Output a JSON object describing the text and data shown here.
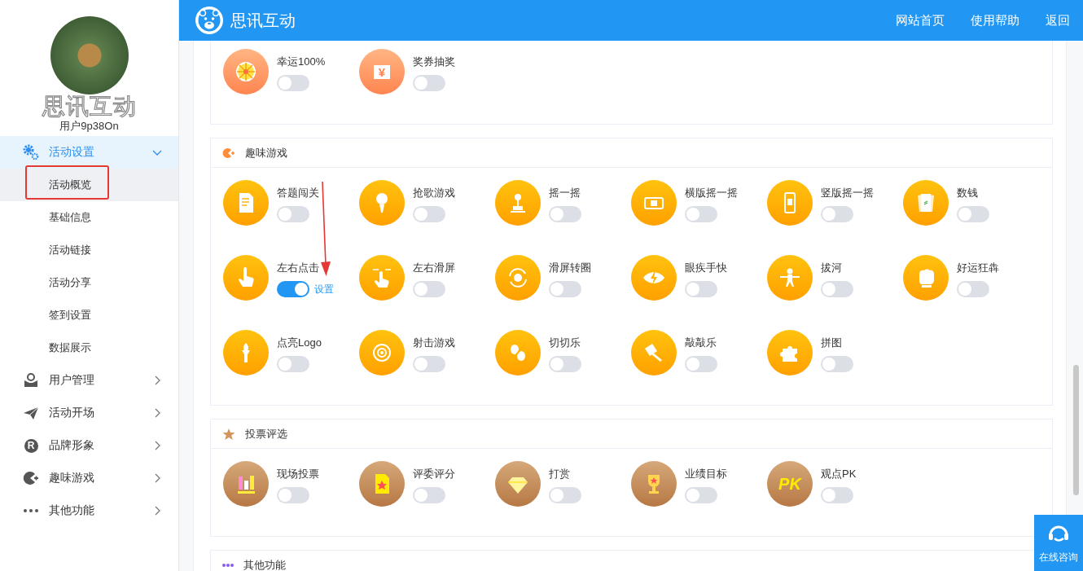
{
  "sidebar": {
    "logo_text": "思讯互动",
    "username": "用户9p38On",
    "menu": [
      {
        "label": "活动设置",
        "selected": true,
        "expanded": true,
        "children": [
          {
            "label": "活动概览",
            "selected": true,
            "annotated": true
          },
          {
            "label": "基础信息",
            "selected": false,
            "annotated": false
          },
          {
            "label": "活动链接",
            "selected": false,
            "annotated": false
          },
          {
            "label": "活动分享",
            "selected": false,
            "annotated": false
          },
          {
            "label": "签到设置",
            "selected": false,
            "annotated": false
          },
          {
            "label": "数据展示",
            "selected": false,
            "annotated": false
          }
        ]
      },
      {
        "label": "用户管理",
        "selected": false,
        "expanded": false
      },
      {
        "label": "活动开场",
        "selected": false,
        "expanded": false
      },
      {
        "label": "品牌形象",
        "selected": false,
        "expanded": false,
        "icon_text": "R"
      },
      {
        "label": "趣味游戏",
        "selected": false,
        "expanded": false
      },
      {
        "label": "其他功能",
        "selected": false,
        "expanded": false
      }
    ]
  },
  "header": {
    "title": "思讯互动",
    "links": [
      "网站首页",
      "使用帮助",
      "返回"
    ]
  },
  "sections": [
    {
      "kind": "lottery",
      "items": [
        {
          "label": "幸运100%",
          "on": false
        },
        {
          "label": "奖券抽奖",
          "on": false,
          "icon_text": "¥"
        }
      ]
    },
    {
      "kind": "game",
      "title": "趣味游戏",
      "items": [
        {
          "label": "答题闯关",
          "on": false
        },
        {
          "label": "抢歌游戏",
          "on": false
        },
        {
          "label": "摇一摇",
          "on": false
        },
        {
          "label": "横版摇一摇",
          "on": false
        },
        {
          "label": "竖版摇一摇",
          "on": false
        },
        {
          "label": "数钱",
          "on": false
        },
        {
          "label": "左右点击",
          "on": true,
          "settings": "设置",
          "annotated": true
        },
        {
          "label": "左右滑屏",
          "on": false
        },
        {
          "label": "滑屏转圈",
          "on": false
        },
        {
          "label": "眼疾手快",
          "on": false
        },
        {
          "label": "拔河",
          "on": false
        },
        {
          "label": "好运狂犇",
          "on": false
        },
        {
          "label": "点亮Logo",
          "on": false
        },
        {
          "label": "射击游戏",
          "on": false
        },
        {
          "label": "切切乐",
          "on": false
        },
        {
          "label": "敲敲乐",
          "on": false
        },
        {
          "label": "拼图",
          "on": false
        }
      ]
    },
    {
      "kind": "vote",
      "title": "投票评选",
      "items": [
        {
          "label": "现场投票",
          "on": false
        },
        {
          "label": "评委评分",
          "on": false
        },
        {
          "label": "打赏",
          "on": false
        },
        {
          "label": "业绩目标",
          "on": false
        },
        {
          "label": "观点PK",
          "on": false,
          "icon_text": "PK"
        }
      ]
    },
    {
      "kind": "other",
      "title": "其他功能"
    }
  ],
  "consult_button": "在线咨询"
}
